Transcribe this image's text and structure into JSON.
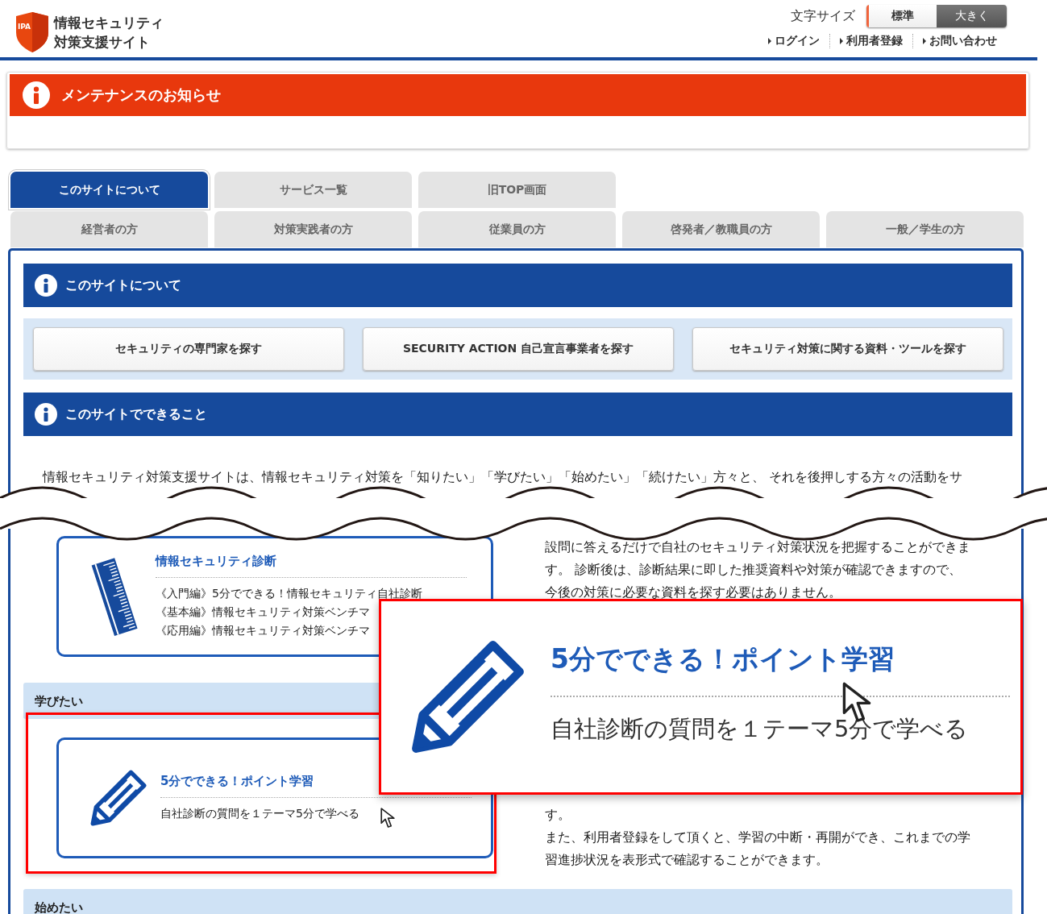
{
  "header": {
    "logo_badge": "IPA",
    "logo_lines": [
      "情報セキュリティ",
      "対策支援サイト"
    ],
    "font_size_label": "文字サイズ",
    "font_size_options": [
      {
        "label": "標準",
        "selected": true
      },
      {
        "label": "大きく",
        "selected": false
      }
    ],
    "links": [
      "ログイン",
      "利用者登録",
      "お問い合わせ"
    ]
  },
  "notice": {
    "title": "メンテナンスのお知らせ"
  },
  "tab_rows": [
    {
      "tabs": [
        {
          "label": "このサイトについて",
          "selected": true
        },
        {
          "label": "サービス一覧",
          "selected": false
        },
        {
          "label": "旧TOP画面",
          "selected": false
        }
      ]
    },
    {
      "tabs": [
        {
          "label": "経営者の方",
          "selected": false
        },
        {
          "label": "対策実践者の方",
          "selected": false
        },
        {
          "label": "従業員の方",
          "selected": false
        },
        {
          "label": "啓発者／教職員の方",
          "selected": false
        },
        {
          "label": "一般／学生の方",
          "selected": false
        }
      ]
    }
  ],
  "panel": {
    "about_heading": "このサイトについて",
    "search_buttons": [
      "セキュリティの専門家を探す",
      "SECURITY ACTION 自己宣言事業者を探す",
      "セキュリティ対策に関する資料・ツールを探す"
    ],
    "features_heading": "このサイトでできること",
    "intro": "情報セキュリティ対策支援サイトは、情報セキュリティ対策を「知りたい」「学びたい」「始めたい」「続けたい」方々と、 それを後押しする方々の活動をサ",
    "sections": [
      {
        "card": {
          "kind": "ruler",
          "title": "情報セキュリティ診断",
          "lines": [
            "《入門編》5分でできる！情報セキュリティ自社診断",
            "《基本編》情報セキュリティ対策ベンチマ",
            "《応用編》情報セキュリティ対策ベンチマ"
          ]
        },
        "description": [
          "設問に答えるだけで自社のセキュリティ対策状況を把握することができます。 診断後は、診断結果に即した推奨資料や対策が確認できますので、今後の対策に必要な資料を探す必要はありません。"
        ]
      },
      {
        "heading": "学びたい",
        "highlighted": true,
        "card": {
          "kind": "pencil",
          "title": "5分でできる！ポイント学習",
          "lines": [
            "自社診断の質問を１テーマ5分で学べる"
          ]
        },
        "description": [
          "す。",
          "また、利用者登録をして頂くと、学習の中断・再開ができ、これまでの学習進捗状況を表形式で確認することができます。"
        ]
      },
      {
        "heading": "始めたい"
      }
    ]
  },
  "callout": {
    "kind": "pencil",
    "title": "5分でできる！ポイント学習",
    "description": "自社診断の質問を１テーマ5分で学べる"
  }
}
